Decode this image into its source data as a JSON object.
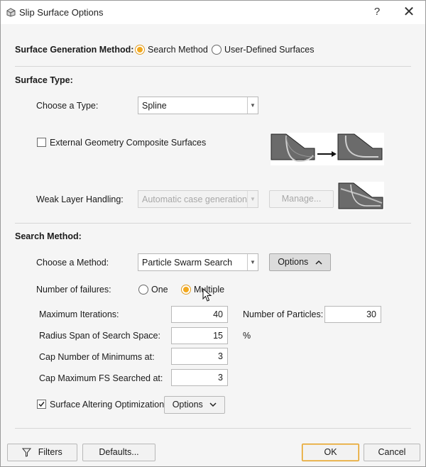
{
  "window": {
    "title": "Slip Surface Options",
    "app_icon": "app-icon",
    "help": "?",
    "close": "✕"
  },
  "surface_generation": {
    "label": "Surface Generation Method:",
    "options": [
      "Search Method",
      "User-Defined Surfaces"
    ],
    "selected": "Search Method"
  },
  "surface_type": {
    "heading": "Surface Type:",
    "choose_label": "Choose a Type:",
    "type_value": "Spline",
    "external_geometry_label": "External Geometry Composite Surfaces",
    "external_geometry_checked": false,
    "weak_layer_label": "Weak Layer Handling:",
    "weak_layer_value": "Automatic case generation",
    "manage_button": "Manage..."
  },
  "search_method": {
    "heading": "Search Method:",
    "choose_label": "Choose a Method:",
    "method_value": "Particle Swarm Search",
    "options_button": "Options",
    "failures_label": "Number of failures:",
    "failures_options": [
      "One",
      "Multiple"
    ],
    "failures_selected": "Multiple",
    "max_iterations_label": "Maximum Iterations:",
    "max_iterations": "40",
    "num_particles_label": "Number of Particles:",
    "num_particles": "30",
    "radius_span_label": "Radius Span of Search Space:",
    "radius_span": "15",
    "radius_unit": "%",
    "cap_minimums_label": "Cap Number of Minimums at:",
    "cap_minimums": "3",
    "cap_fs_label": "Cap Maximum FS Searched at:",
    "cap_fs": "3",
    "surface_altering_label": "Surface Altering Optimization",
    "surface_altering_checked": true,
    "surface_altering_options": "Options"
  },
  "footer": {
    "filters": "Filters",
    "defaults": "Defaults...",
    "ok": "OK",
    "cancel": "Cancel"
  },
  "colors": {
    "accent": "#f2a81d",
    "slope_fill": "#6b6b6b"
  }
}
